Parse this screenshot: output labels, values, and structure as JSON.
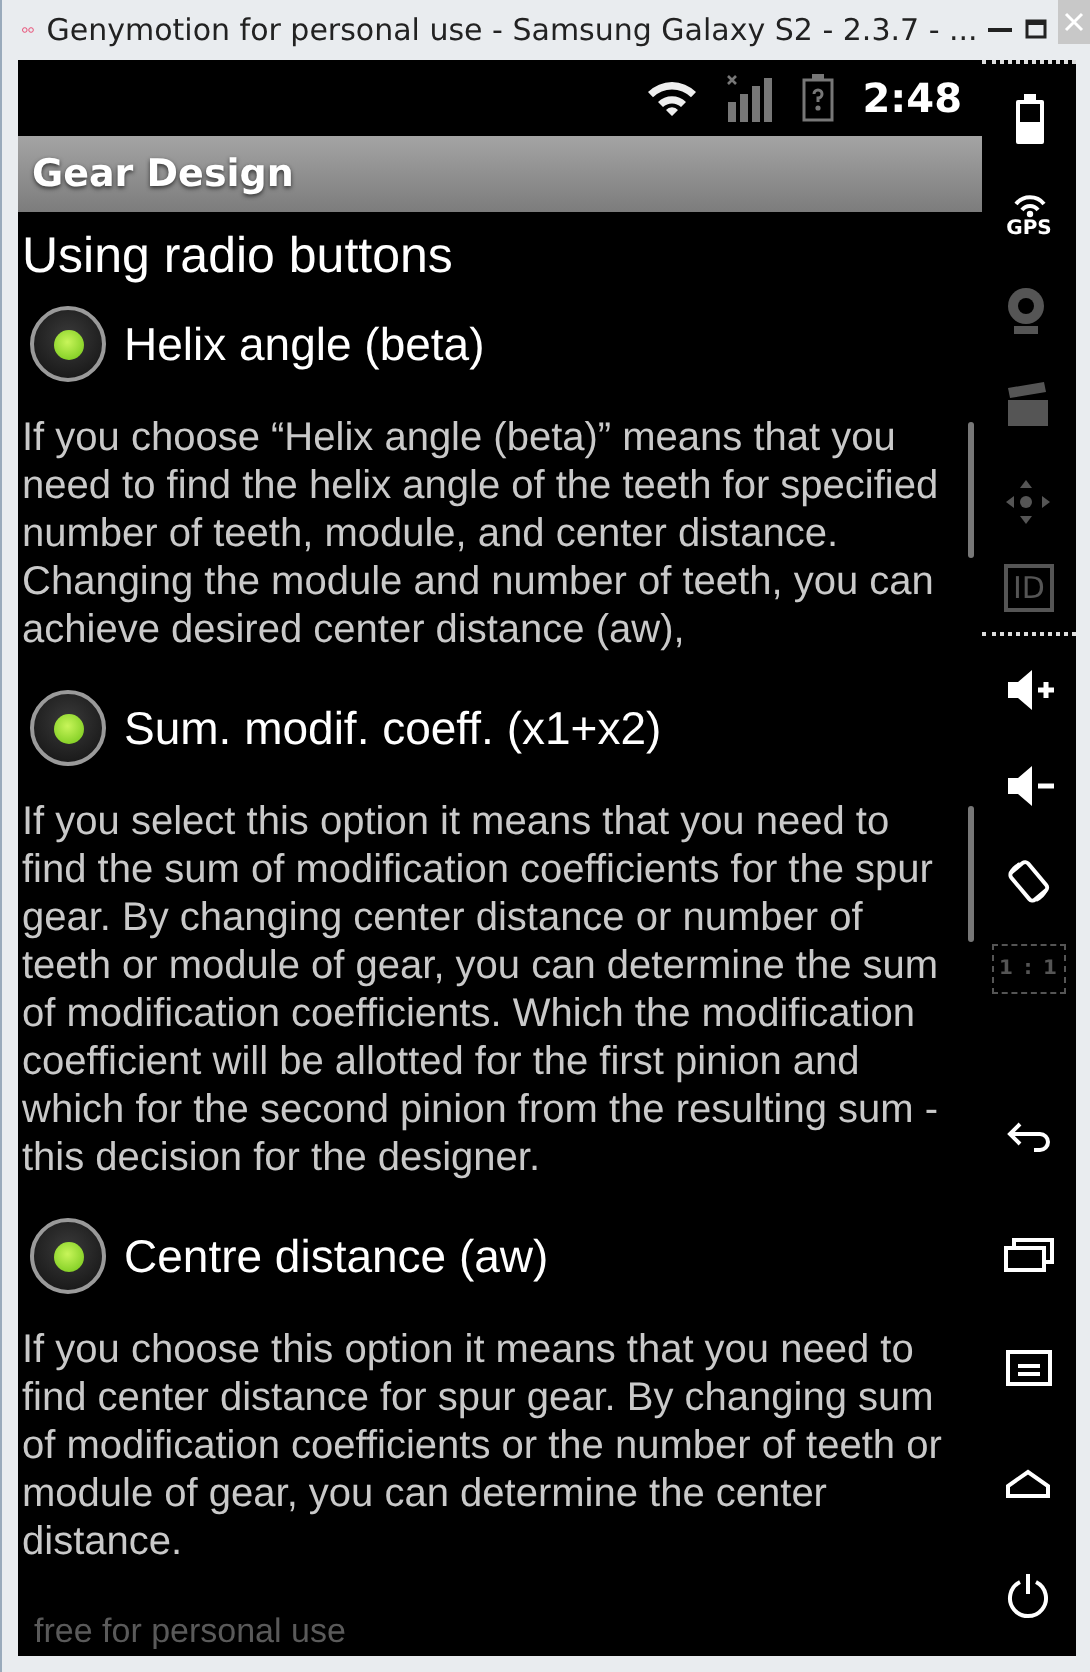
{
  "window": {
    "title": "Genymotion for personal use - Samsung Galaxy S2 - 2.3.7 - ..."
  },
  "status_bar": {
    "time": "2:48"
  },
  "action_bar": {
    "title": "Gear Design"
  },
  "heading": "Using radio buttons",
  "options": [
    {
      "label": "Helix angle (beta)",
      "selected": true,
      "description": "If you choose “Helix angle (beta)” means that you need to find the helix angle of the teeth for specified number of teeth, module, and center distance. Changing the module and number of teeth, you can achieve desired center distance (aw),"
    },
    {
      "label": "Sum. modif. coeff. (x1+x2)",
      "selected": true,
      "description": "If you select this option it means that you need to find the sum of modification coefficients for the spur gear. By changing center distance or number of teeth or module of gear, you can determine the sum of modification coefficients. Which the modification coefficient will be allotted for the first pinion and which for the second pinion from the resulting sum - this decision for the designer."
    },
    {
      "label": "Centre distance (aw)",
      "selected": true,
      "description": "If you choose this option it means that you need to find center distance for spur gear. By changing sum of modification coefficients or the number of teeth or module of gear, you can determine the center distance."
    }
  ],
  "sidebar": {
    "sensors": [
      {
        "kind": "battery",
        "disabled": false
      },
      {
        "kind": "gps",
        "label": "GPS",
        "disabled": false
      },
      {
        "kind": "camera",
        "disabled": true
      },
      {
        "kind": "clapper",
        "disabled": true
      },
      {
        "kind": "dpad",
        "disabled": true
      },
      {
        "kind": "id",
        "label": "ID",
        "disabled": true
      }
    ],
    "controls": [
      {
        "kind": "volume_up",
        "disabled": false
      },
      {
        "kind": "volume_down",
        "disabled": false
      },
      {
        "kind": "rotate",
        "disabled": false
      },
      {
        "kind": "scale",
        "label": "1 : 1",
        "disabled": true
      }
    ],
    "nav": [
      {
        "kind": "back",
        "disabled": false
      },
      {
        "kind": "recent",
        "disabled": false
      },
      {
        "kind": "menu",
        "disabled": false
      },
      {
        "kind": "home",
        "disabled": false
      },
      {
        "kind": "power",
        "disabled": false
      }
    ]
  },
  "watermark": "free for personal use"
}
